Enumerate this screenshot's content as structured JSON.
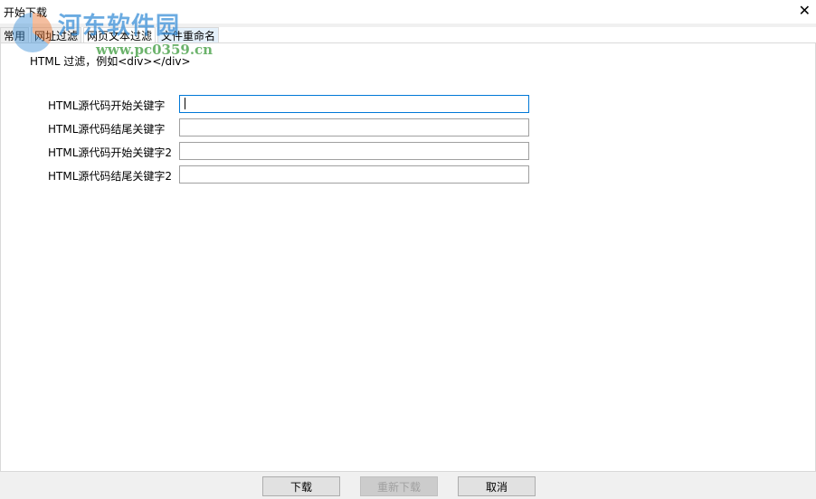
{
  "window": {
    "title": "开始下载",
    "close_icon": "close-icon"
  },
  "tabs": [
    {
      "label": "常用"
    },
    {
      "label": "网址过滤"
    },
    {
      "label": "网页文本过滤"
    },
    {
      "label": "文件重命名"
    }
  ],
  "panel": {
    "hint": "HTML 过滤，例如<div></div>",
    "fields": [
      {
        "label": "HTML源代码开始关键字",
        "value": ""
      },
      {
        "label": "HTML源代码结尾关键字",
        "value": ""
      },
      {
        "label": "HTML源代码开始关键字2",
        "value": ""
      },
      {
        "label": "HTML源代码结尾关键字2",
        "value": ""
      }
    ]
  },
  "buttons": {
    "download": "下载",
    "redownload": "重新下载",
    "cancel": "取消"
  },
  "watermark": {
    "name": "河东软件园",
    "url": "www.pc0359.cn"
  }
}
